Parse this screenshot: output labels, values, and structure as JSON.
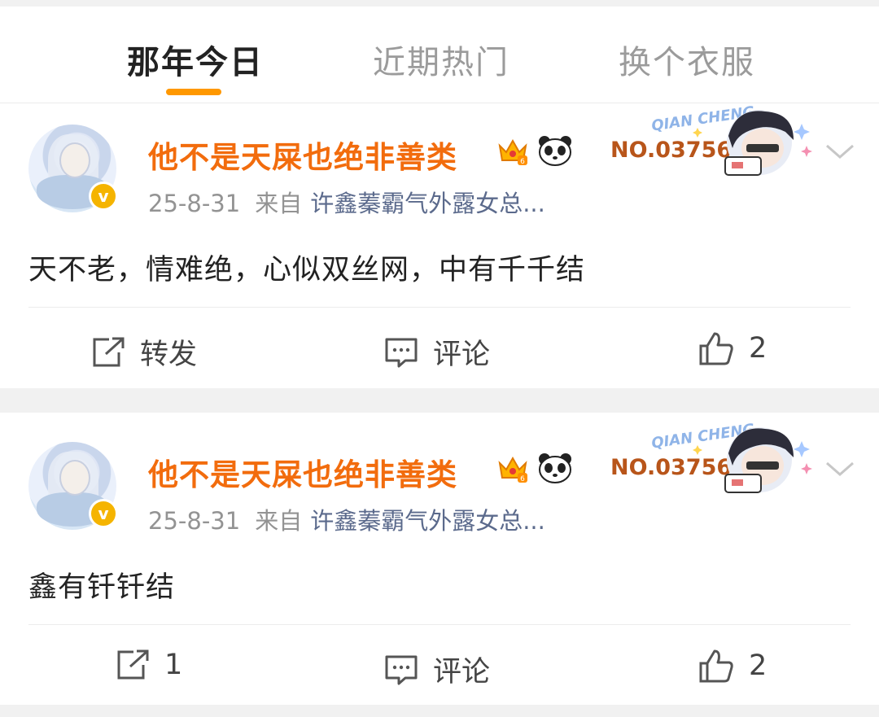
{
  "tabs": [
    "那年今日",
    "近期热门",
    "换个衣服"
  ],
  "active_tab": 0,
  "posts": [
    {
      "username": "他不是天屎也绝非善类",
      "fan_number": "NO.03756",
      "deco_text": "QIAN CHENG",
      "date": "25-8-31",
      "from_label": "来自",
      "client": "许鑫蓁霸气外露女总...",
      "verified_label": "v",
      "content": "天不老，情难绝，心似双丝网，中有千千结",
      "actions": {
        "repost": "转发",
        "comment": "评论",
        "like_count": "2"
      }
    },
    {
      "username": "他不是天屎也绝非善类",
      "fan_number": "NO.03756",
      "deco_text": "QIAN CHENG",
      "date": "25-8-31",
      "from_label": "来自",
      "client": "许鑫蓁霸气外露女总...",
      "verified_label": "v",
      "content": "鑫有钎钎结",
      "actions": {
        "repost": "1",
        "comment": "评论",
        "like_count": "2"
      }
    }
  ],
  "colors": {
    "username": "#f26c0d",
    "tab_indicator": "#ff9800",
    "verified": "#f5b400",
    "client_link": "#5b6a8c"
  },
  "icons": [
    "crown-badge-icon",
    "panda-icon",
    "chevron-down-icon",
    "repost-icon",
    "comment-icon",
    "like-icon"
  ]
}
